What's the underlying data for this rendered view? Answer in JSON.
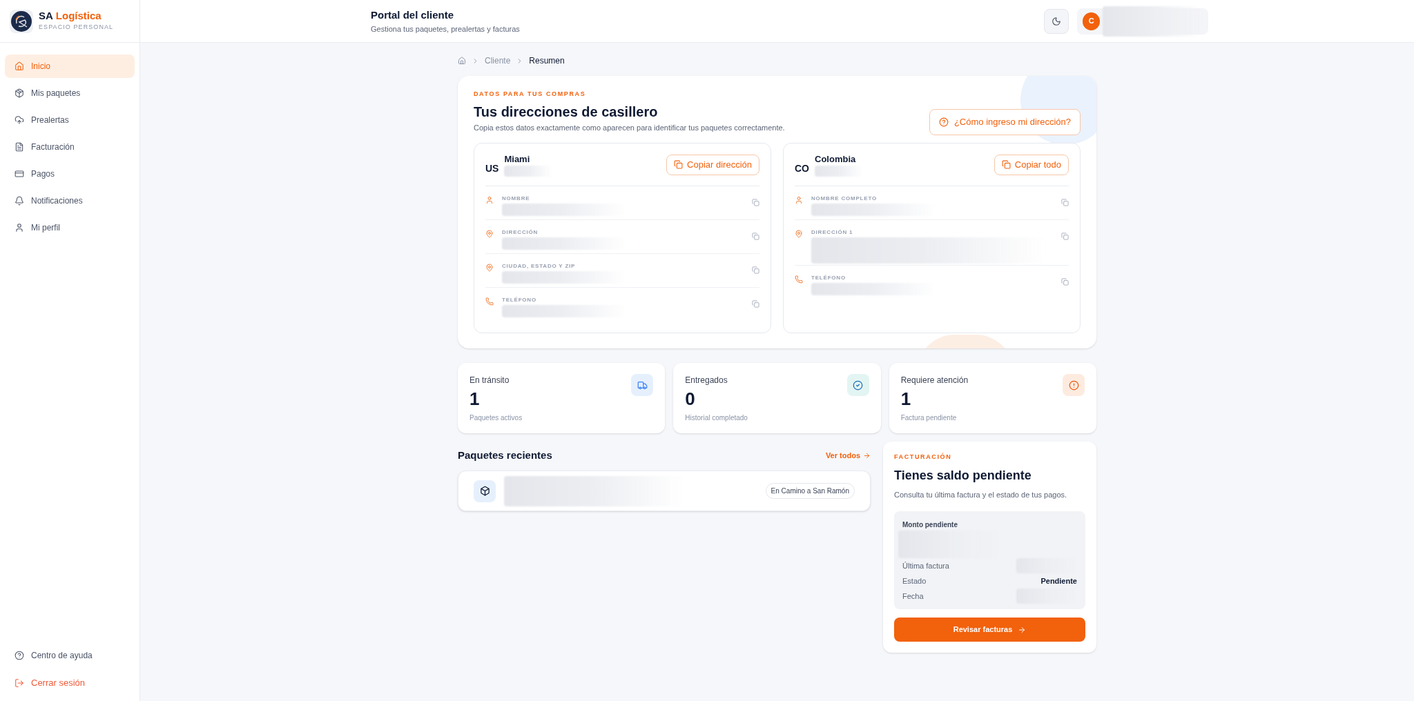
{
  "brand": {
    "name_a": "SA",
    "name_b": "Logística",
    "subtitle": "ESPACIO PERSONAL"
  },
  "sidebar": {
    "items": [
      {
        "label": "Inicio",
        "selected": true
      },
      {
        "label": "Mis paquetes",
        "selected": false
      },
      {
        "label": "Prealertas",
        "selected": false
      },
      {
        "label": "Facturación",
        "selected": false
      },
      {
        "label": "Pagos",
        "selected": false
      },
      {
        "label": "Notificaciones",
        "selected": false
      },
      {
        "label": "Mi perfil",
        "selected": false
      }
    ],
    "footer": [
      {
        "label": "Centro de ayuda",
        "kind": "help"
      },
      {
        "label": "Cerrar sesión",
        "kind": "logout"
      }
    ]
  },
  "header": {
    "title": "Portal del cliente",
    "subtitle": "Gestiona tus paquetes, prealertas y facturas",
    "avatar": "C"
  },
  "breadcrumb": [
    "Cliente",
    "Resumen"
  ],
  "addresses": {
    "eyebrow": "DATOS PARA TUS COMPRAS",
    "title": "Tus direcciones de casillero",
    "description": "Copia estos datos exactamente como aparecen para identificar tus paquetes correctamente.",
    "help_button": "¿Cómo ingreso mi dirección?",
    "cards": [
      {
        "code": "US",
        "name": "Miami",
        "action": "Copiar dirección",
        "fields": [
          {
            "label": "NOMBRE",
            "kind": "person"
          },
          {
            "label": "DIRECCIÓN",
            "kind": "pin"
          },
          {
            "label": "CIUDAD, ESTADO Y ZIP",
            "kind": "pin"
          },
          {
            "label": "TELÉFONO",
            "kind": "phone"
          }
        ]
      },
      {
        "code": "CO",
        "name": "Colombia",
        "action": "Copiar todo",
        "fields": [
          {
            "label": "NOMBRE COMPLETO",
            "kind": "person"
          },
          {
            "label": "DIRECCIÓN 1",
            "kind": "address"
          },
          {
            "label": "TELÉFONO",
            "kind": "phone"
          }
        ]
      }
    ]
  },
  "stats": [
    {
      "label": "En tránsito",
      "value": "1",
      "note": "Paquetes activos",
      "kind": "transit"
    },
    {
      "label": "Entregados",
      "value": "0",
      "note": "Historial completado",
      "kind": "delivered"
    },
    {
      "label": "Requiere atención",
      "value": "1",
      "note": "Factura pendiente",
      "kind": "attention"
    }
  ],
  "recent": {
    "title": "Paquetes recientes",
    "link": "Ver todos",
    "packages": [
      {
        "status": "En Camino a San Ramón"
      }
    ]
  },
  "billing": {
    "eyebrow": "FACTURACIÓN",
    "title": "Tienes saldo pendiente",
    "description": "Consulta tu última factura y el estado de tus pagos.",
    "amount_label": "Monto pendiente",
    "rows": [
      {
        "label": "Última factura"
      },
      {
        "label": "Estado",
        "value": "Pendiente"
      },
      {
        "label": "Fecha"
      }
    ],
    "button": "Revisar facturas"
  }
}
